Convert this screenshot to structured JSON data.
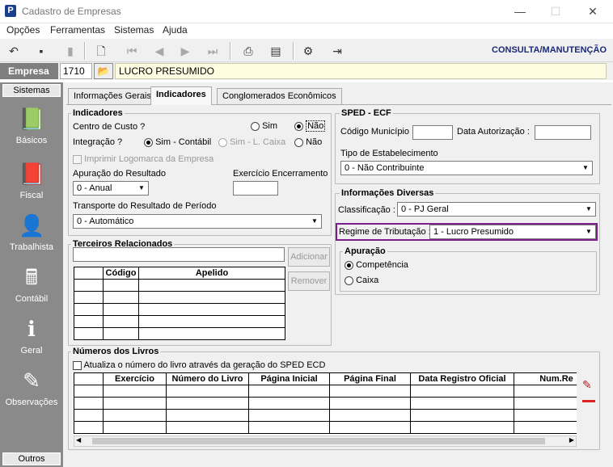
{
  "window": {
    "title": "Cadastro de Empresas",
    "minimize": "—",
    "maximize": "☐",
    "close": "✕"
  },
  "menu": [
    "Opções",
    "Ferramentas",
    "Sistemas",
    "Ajuda"
  ],
  "toolbar": {
    "mode": "CONSULTA/MANUTENÇÃO"
  },
  "empresa": {
    "label": "Empresa",
    "code": "1710",
    "name": "LUCRO PRESUMIDO"
  },
  "sidebar": {
    "header": "Sistemas",
    "items": [
      {
        "label": "Básicos",
        "icon": "book-icon"
      },
      {
        "label": "Fiscal",
        "icon": "ledger-icon"
      },
      {
        "label": "Trabalhista",
        "icon": "person-icon"
      },
      {
        "label": "Contábil",
        "icon": "calculator-icon"
      },
      {
        "label": "Geral",
        "icon": "info-icon"
      },
      {
        "label": "Observações",
        "icon": "pencil-icon"
      }
    ],
    "footer": "Outros"
  },
  "tabs": [
    "Informações Gerais",
    "Indicadores",
    "Conglomerados Econômicos"
  ],
  "indicadores": {
    "title": "Indicadores",
    "centro_custo": {
      "label": "Centro de Custo ?",
      "opt1": "Sim",
      "opt2": "Não"
    },
    "integracao": {
      "label": "Integração ?",
      "opt1": "Sim - Contábil",
      "opt2": "Sim - L. Caixa",
      "opt3": "Não"
    },
    "imprimir_logo": "Imprimir Logomarca da Empresa",
    "apuracao": {
      "label": "Apuração do Resultado",
      "value": "0 - Anual"
    },
    "exercicio": {
      "label": "Exercício Encerramento",
      "value": ""
    },
    "transporte": {
      "label": "Transporte do Resultado de Período",
      "value": "0 - Automático"
    }
  },
  "terceiros": {
    "title": "Terceiros Relacionados",
    "search_value": "",
    "columns": [
      "Código",
      "Apelido"
    ],
    "add": "Adicionar",
    "remove": "Remover"
  },
  "sped": {
    "title": "SPED - ECF",
    "municipio_label": "Código Município :",
    "autorizacao_label": "Data Autorização :",
    "tipo_label": "Tipo de Estabelecimento",
    "tipo_value": "0 - Não Contribuinte"
  },
  "diversas": {
    "title": "Informações Diversas",
    "classificacao_label": "Classificação :",
    "classificacao_value": "0 - PJ Geral",
    "regime_label": "Regime de Tributação :",
    "regime_value": "1 - Lucro Presumido",
    "apuracao_title": "Apuração",
    "competencia": "Competência",
    "caixa": "Caixa"
  },
  "livros": {
    "title": "Números dos Livros",
    "atualiza": "Atualiza o número do livro através da geração do SPED ECD",
    "columns": [
      "Exercício",
      "Número do Livro",
      "Página Inicial",
      "Página Final",
      "Data Registro Oficial",
      "Num.Re"
    ]
  },
  "colors": {
    "accent": "#1c2a78",
    "highlight": "#7b1f8c",
    "sidebar": "#8a8a8a"
  }
}
